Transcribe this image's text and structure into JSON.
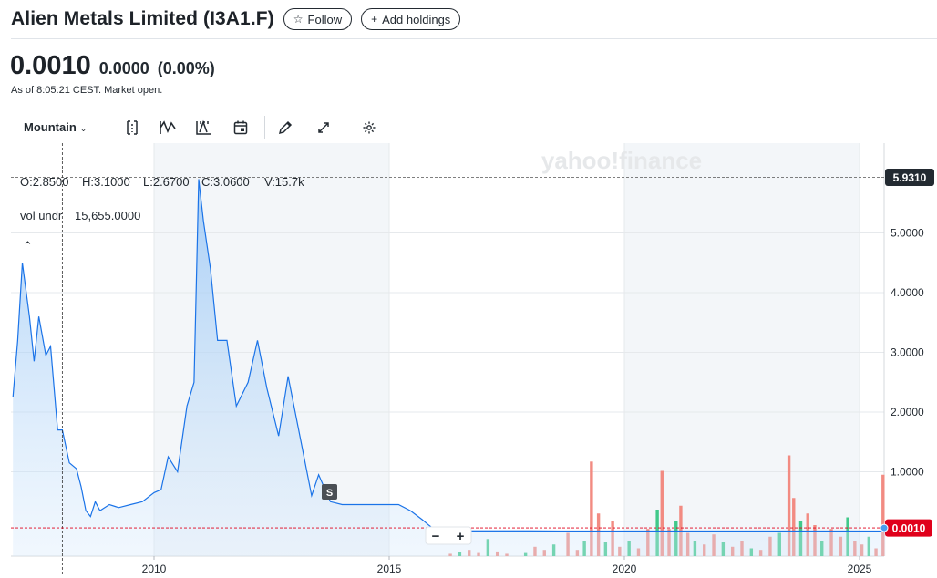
{
  "header": {
    "title": "Alien Metals Limited (I3A1.F)",
    "follow_label": "Follow",
    "add_holdings_label": "Add holdings"
  },
  "quote": {
    "price": "0.0010",
    "change": "0.0000",
    "change_pct": "(0.00%)",
    "as_of": "As of 8:05:21 CEST. Market open."
  },
  "toolbar": {
    "range_label": "Mountain",
    "icons": [
      "date-range-icon",
      "indicators-icon",
      "comparison-icon",
      "calendar-events-icon",
      "draw-icon",
      "expand-icon",
      "settings-icon"
    ]
  },
  "chart_data": {
    "type": "area",
    "watermark": "yahoo!finance",
    "crosshair_price_label": "5.9310",
    "last_price_label": "0.0010",
    "ohlc": {
      "open": "O:2.8500",
      "high": "H:3.1000",
      "low": "L:2.6700",
      "close": "C:3.0600",
      "volume": "V:15.7k"
    },
    "indicator": {
      "name": "vol undr",
      "value": "15,655.0000"
    },
    "event_marker": "S",
    "zoom": {
      "minus": "−",
      "plus": "+"
    },
    "x_ticks": [
      "2010",
      "2015",
      "2020",
      "2025"
    ],
    "y_ticks": [
      "5.0000",
      "4.0000",
      "3.0000",
      "2.0000",
      "1.0000"
    ],
    "colors": {
      "line": "#1a73e8",
      "volume_up": "#40c98a",
      "volume_down": "#f28b82",
      "last_price": "#e0001b"
    },
    "series": [
      {
        "x": [
          2007.0,
          2007.1,
          2007.2,
          2007.35,
          2007.45,
          2007.55,
          2007.7,
          2007.8,
          2007.95,
          2008.05,
          2008.2,
          2008.35,
          2008.45,
          2008.55,
          2008.65,
          2008.75,
          2008.85,
          2009.05,
          2009.25,
          2009.5,
          2009.75,
          2010.0,
          2010.15,
          2010.3,
          2010.5,
          2010.7,
          2010.85,
          2010.95,
          2011.05,
          2011.2,
          2011.35,
          2011.55,
          2011.75,
          2012.0,
          2012.2,
          2012.4,
          2012.65,
          2012.85,
          2013.1,
          2013.35,
          2013.5,
          2013.75,
          2014.0,
          2014.25,
          2014.55,
          2014.85,
          2015.2,
          2015.45,
          2015.7,
          2015.85,
          2016.0,
          2017.0,
          2018.0,
          2019.0,
          2020.0,
          2021.0,
          2022.0,
          2023.0,
          2024.0,
          2025.0,
          2025.55
        ],
        "y": [
          2.25,
          3.2,
          4.5,
          3.6,
          2.85,
          3.6,
          2.95,
          3.1,
          1.7,
          1.7,
          1.15,
          1.05,
          0.75,
          0.35,
          0.25,
          0.5,
          0.35,
          0.45,
          0.4,
          0.45,
          0.5,
          0.65,
          0.7,
          1.25,
          1.0,
          2.1,
          2.5,
          5.9,
          5.2,
          4.4,
          3.2,
          3.2,
          2.1,
          2.5,
          3.2,
          2.4,
          1.6,
          2.6,
          1.6,
          0.6,
          0.95,
          0.5,
          0.45,
          0.45,
          0.45,
          0.45,
          0.45,
          0.35,
          0.2,
          0.1,
          0.01,
          0.01,
          0.01,
          0.005,
          0.005,
          0.005,
          0.003,
          0.002,
          0.001,
          0.001,
          0.001
        ]
      }
    ],
    "volume_bars": [
      {
        "x": 2016.3,
        "v": 0.03
      },
      {
        "x": 2016.5,
        "v": 0.05
      },
      {
        "x": 2016.7,
        "v": 0.08
      },
      {
        "x": 2016.9,
        "v": 0.04
      },
      {
        "x": 2017.1,
        "v": 0.22
      },
      {
        "x": 2017.3,
        "v": 0.06
      },
      {
        "x": 2017.5,
        "v": 0.03
      },
      {
        "x": 2017.9,
        "v": 0.04
      },
      {
        "x": 2018.1,
        "v": 0.12
      },
      {
        "x": 2018.3,
        "v": 0.08
      },
      {
        "x": 2018.5,
        "v": 0.15
      },
      {
        "x": 2018.8,
        "v": 0.3
      },
      {
        "x": 2019.0,
        "v": 0.08
      },
      {
        "x": 2019.15,
        "v": 0.2
      },
      {
        "x": 2019.3,
        "v": 1.22
      },
      {
        "x": 2019.45,
        "v": 0.55
      },
      {
        "x": 2019.6,
        "v": 0.18
      },
      {
        "x": 2019.75,
        "v": 0.45
      },
      {
        "x": 2019.9,
        "v": 0.12
      },
      {
        "x": 2020.1,
        "v": 0.2
      },
      {
        "x": 2020.3,
        "v": 0.1
      },
      {
        "x": 2020.5,
        "v": 0.35
      },
      {
        "x": 2020.7,
        "v": 0.6
      },
      {
        "x": 2020.8,
        "v": 1.1
      },
      {
        "x": 2020.95,
        "v": 0.35
      },
      {
        "x": 2021.1,
        "v": 0.45
      },
      {
        "x": 2021.2,
        "v": 0.65
      },
      {
        "x": 2021.35,
        "v": 0.3
      },
      {
        "x": 2021.5,
        "v": 0.2
      },
      {
        "x": 2021.7,
        "v": 0.15
      },
      {
        "x": 2021.9,
        "v": 0.28
      },
      {
        "x": 2022.1,
        "v": 0.18
      },
      {
        "x": 2022.3,
        "v": 0.12
      },
      {
        "x": 2022.5,
        "v": 0.2
      },
      {
        "x": 2022.7,
        "v": 0.1
      },
      {
        "x": 2022.9,
        "v": 0.08
      },
      {
        "x": 2023.1,
        "v": 0.25
      },
      {
        "x": 2023.3,
        "v": 0.3
      },
      {
        "x": 2023.5,
        "v": 1.3
      },
      {
        "x": 2023.6,
        "v": 0.75
      },
      {
        "x": 2023.75,
        "v": 0.45
      },
      {
        "x": 2023.9,
        "v": 0.55
      },
      {
        "x": 2024.05,
        "v": 0.4
      },
      {
        "x": 2024.2,
        "v": 0.2
      },
      {
        "x": 2024.4,
        "v": 0.35
      },
      {
        "x": 2024.6,
        "v": 0.25
      },
      {
        "x": 2024.75,
        "v": 0.5
      },
      {
        "x": 2024.9,
        "v": 0.2
      },
      {
        "x": 2025.05,
        "v": 0.15
      },
      {
        "x": 2025.2,
        "v": 0.25
      },
      {
        "x": 2025.35,
        "v": 0.1
      },
      {
        "x": 2025.5,
        "v": 1.05
      }
    ]
  }
}
